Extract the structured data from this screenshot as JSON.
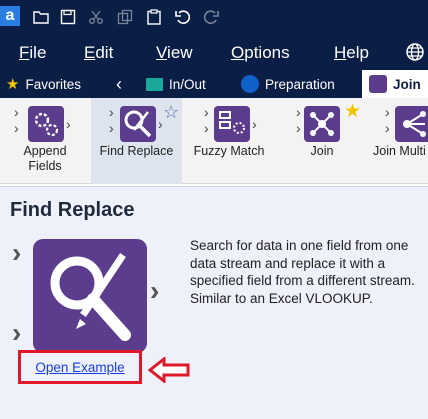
{
  "app": {
    "logo_letter": "a"
  },
  "menu": {
    "items": [
      {
        "underlined": "F",
        "rest": "ile"
      },
      {
        "underlined": "E",
        "rest": "dit"
      },
      {
        "underlined": "V",
        "rest": "iew"
      },
      {
        "underlined": "O",
        "rest": "ptions"
      },
      {
        "underlined": "H",
        "rest": "elp"
      }
    ]
  },
  "tabs": [
    {
      "label": "Favorites",
      "icon": "star-icon"
    },
    {
      "label": "In/Out",
      "icon": "folder-icon"
    },
    {
      "label": "Preparation",
      "icon": "circle-icon"
    },
    {
      "label": "Join",
      "icon": "purple-square-icon"
    }
  ],
  "tools": [
    {
      "label_line1": "Append",
      "label_line2": "Fields"
    },
    {
      "label_line1": "Find Replace",
      "label_line2": ""
    },
    {
      "label_line1": "Fuzzy Match",
      "label_line2": ""
    },
    {
      "label_line1": "Join",
      "label_line2": ""
    },
    {
      "label_line1": "Join Multi",
      "label_line2": ""
    }
  ],
  "detail": {
    "title": "Find Replace",
    "description": "Search for data in one field from one data stream and replace it with a specified field from a different stream. Similar to an Excel VLOOKUP.",
    "link": "Open Example"
  },
  "colors": {
    "nav_bg": "#0b1e46",
    "join_purple": "#5c3c8c",
    "highlight_red": "#e0192a",
    "link_blue": "#1a3fd8",
    "star_yellow": "#f5c400"
  }
}
